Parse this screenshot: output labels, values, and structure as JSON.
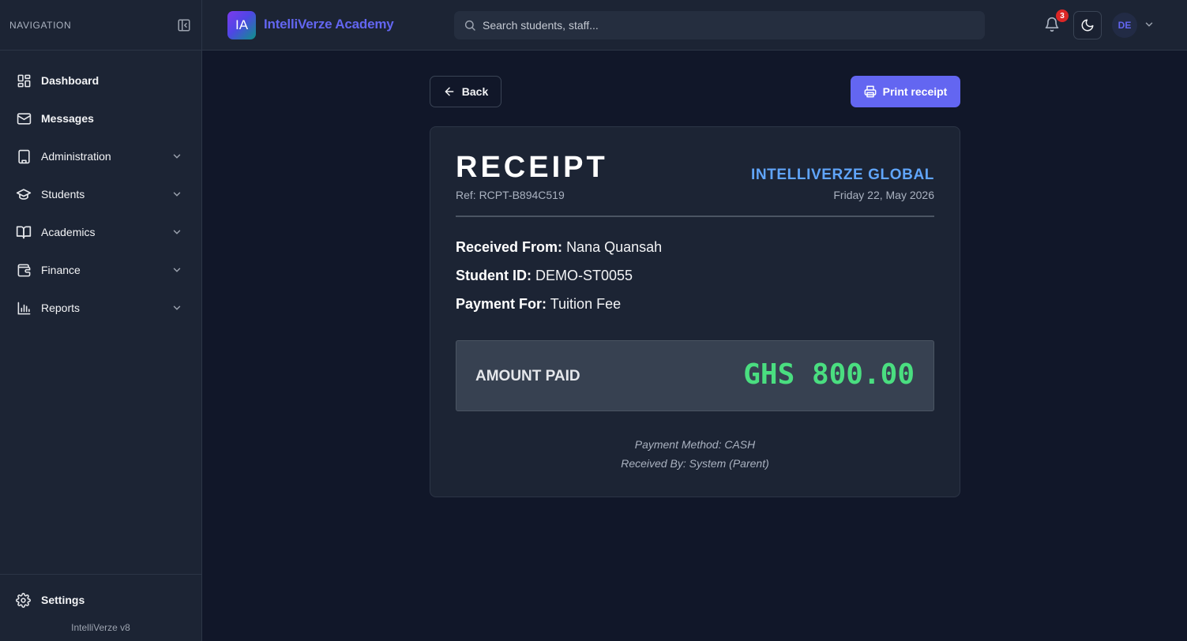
{
  "sidebar": {
    "heading": "NAVIGATION",
    "items": [
      {
        "label": "Dashboard"
      },
      {
        "label": "Messages"
      },
      {
        "label": "Administration"
      },
      {
        "label": "Students"
      },
      {
        "label": "Academics"
      },
      {
        "label": "Finance"
      },
      {
        "label": "Reports"
      }
    ],
    "settings_label": "Settings",
    "version": "IntelliVerze v8"
  },
  "topbar": {
    "logo_initials": "IA",
    "brand": "IntelliVerze Academy",
    "search_placeholder": "Search students, staff...",
    "notification_count": "3",
    "user_initials": "DE"
  },
  "actions": {
    "back_label": "Back",
    "print_label": "Print receipt"
  },
  "receipt": {
    "title": "RECEIPT",
    "ref": "Ref: RCPT-B894C519",
    "organization": "INTELLIVERZE GLOBAL",
    "date": "Friday 22, May 2026",
    "received_from_label": "Received From:",
    "received_from": "Nana Quansah",
    "student_id_label": "Student ID:",
    "student_id": "DEMO-ST0055",
    "payment_for_label": "Payment For:",
    "payment_for": "Tuition Fee",
    "amount_label": "AMOUNT PAID",
    "amount_value": "GHS 800.00",
    "payment_method": "Payment Method: CASH",
    "received_by": "Received By: System (Parent)"
  },
  "colors": {
    "accent": "#6366f1",
    "org_blue": "#60a5fa",
    "amount_green": "#4ade80",
    "badge_red": "#dc2626"
  }
}
